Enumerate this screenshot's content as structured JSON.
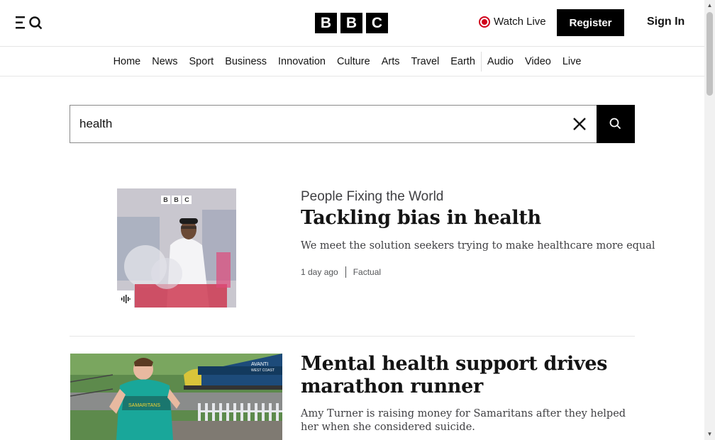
{
  "header": {
    "logo_letters": [
      "B",
      "B",
      "C"
    ],
    "watch_live": "Watch Live",
    "register": "Register",
    "sign_in": "Sign In"
  },
  "nav": {
    "items": [
      "Home",
      "News",
      "Sport",
      "Business",
      "Innovation",
      "Culture",
      "Arts",
      "Travel",
      "Earth",
      "Audio",
      "Video",
      "Live"
    ]
  },
  "search": {
    "value": "health"
  },
  "results": [
    {
      "series": "People Fixing the World",
      "title": "Tackling bias in health",
      "description": "We meet the solution seekers trying to make healthcare more equal",
      "time": "1 day ago",
      "category": "Factual",
      "image_badge_letters": [
        "B",
        "B",
        "C"
      ]
    },
    {
      "title": "Mental health support drives marathon runner",
      "description": "Amy Turner is raising money for Samaritans after they helped her when she considered suicide.",
      "image_train_text": "AVANTI",
      "image_train_subtext": "WEST COAST",
      "image_shirt_text": "SAMARITANS"
    }
  ],
  "colors": {
    "live_red": "#d0021b",
    "black": "#000000",
    "text": "#141414"
  }
}
